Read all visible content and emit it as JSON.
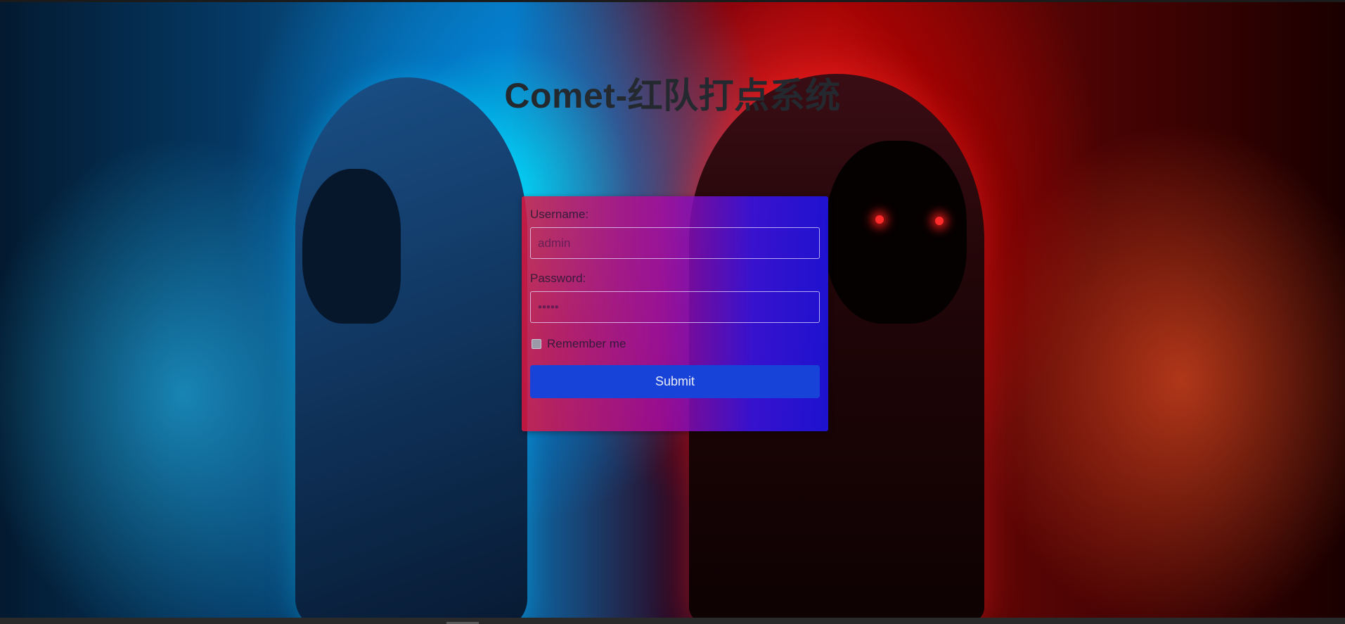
{
  "page": {
    "title": "Comet-红队打点系统"
  },
  "login_form": {
    "username_label": "Username:",
    "username_value": "admin",
    "password_label": "Password:",
    "password_masked_value": "•••••",
    "remember_label": "Remember me",
    "remember_checked": false,
    "submit_label": "Submit"
  },
  "colors": {
    "title_text": "#23292e",
    "submit_button": "#1743d8",
    "form_gradient_left": "#e6143c",
    "form_gradient_right": "#1e14eb"
  },
  "icons": {
    "remember_checkbox": "checkbox-icon"
  }
}
